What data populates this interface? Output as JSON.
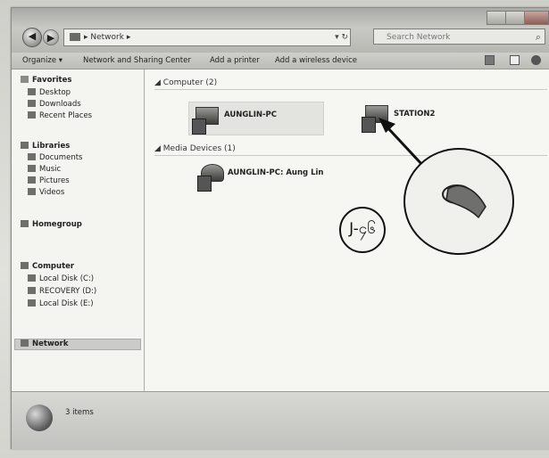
{
  "window": {
    "breadcrumb": "▸ Network ▸",
    "search_placeholder": "Search Network"
  },
  "toolbar": {
    "organize": "Organize ▾",
    "network_sharing": "Network and Sharing Center",
    "add_printer": "Add a printer",
    "add_wireless": "Add a wireless device"
  },
  "nav": {
    "favorites": "Favorites",
    "desktop": "Desktop",
    "downloads": "Downloads",
    "recent_places": "Recent Places",
    "libraries": "Libraries",
    "documents": "Documents",
    "music": "Music",
    "pictures": "Pictures",
    "videos": "Videos",
    "homegroup": "Homegroup",
    "computer": "Computer",
    "local_disk_c": "Local Disk (C:)",
    "recovery_d": "RECOVERY (D:)",
    "local_disk_e": "Local Disk (E:)",
    "network": "Network"
  },
  "content": {
    "group_computer": "Computer (2)",
    "device_1": "AUNGLIN-PC",
    "device_2": "STATION2",
    "group_media": "Media Devices (1)",
    "media_1": "AUNGLIN-PC: Aung Lin"
  },
  "status": {
    "item_count": "3 items"
  },
  "annotation": {
    "callout_number": "J-၄၆"
  }
}
